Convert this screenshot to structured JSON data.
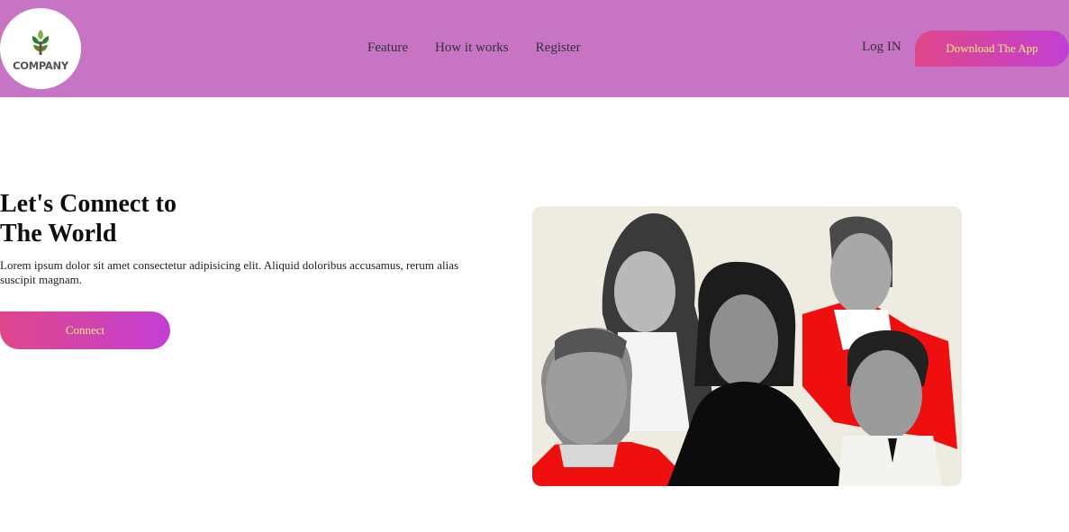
{
  "header": {
    "logo_text": "COMPANY",
    "logo_icon": "leaf-icon",
    "nav": [
      {
        "label": "Feature"
      },
      {
        "label": "How it works"
      },
      {
        "label": "Register"
      }
    ],
    "login_label": "Log IN",
    "download_label": "Download The App"
  },
  "hero": {
    "title_line1": "Let's Connect to",
    "title_line2": "The World",
    "description": "Lorem ipsum dolor sit amet consectetur adipisicing elit. Aliquid doloribus accusamus, rerum alias suscipit magnam.",
    "cta_label": "Connect"
  },
  "colors": {
    "header_bg": "#c874c4",
    "button_gradient_start": "#e0478a",
    "button_gradient_end": "#c23fd3",
    "button_text": "#f5f07a"
  }
}
